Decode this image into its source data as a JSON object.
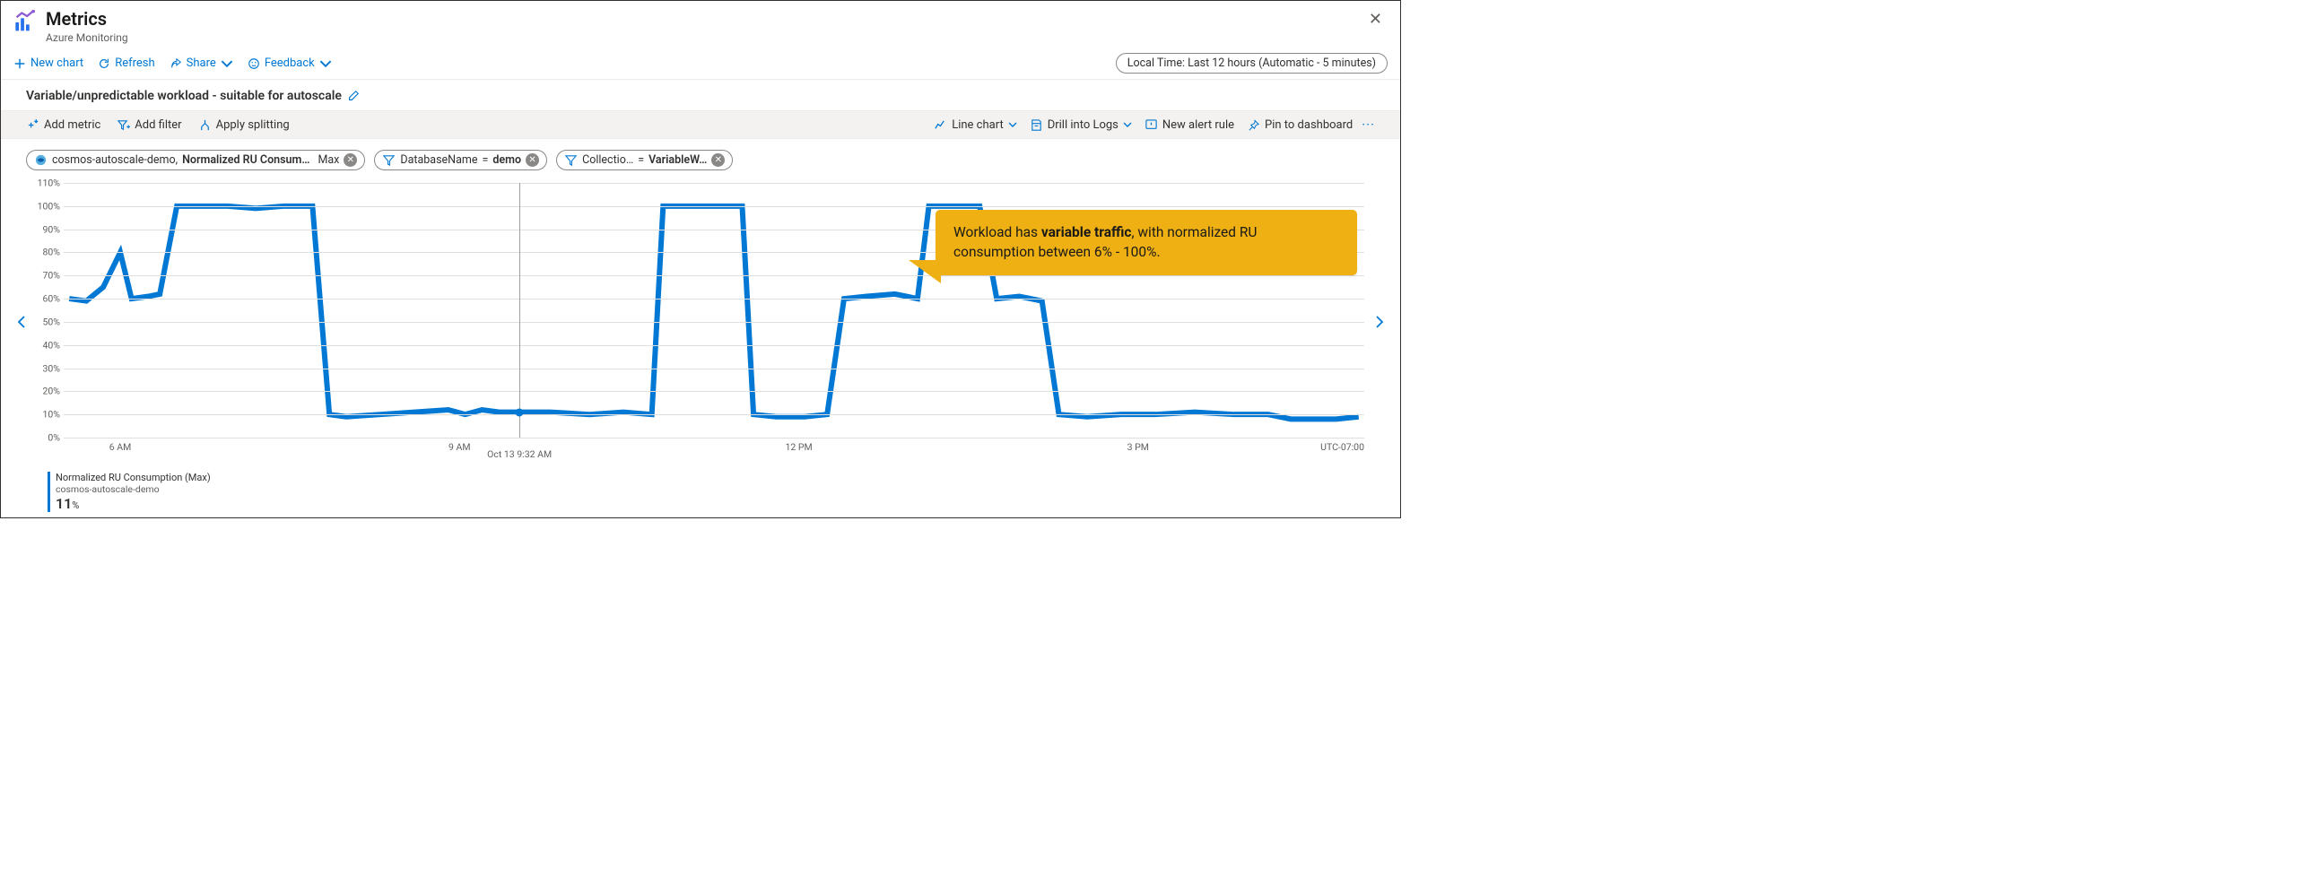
{
  "header": {
    "title": "Metrics",
    "subtitle": "Azure Monitoring"
  },
  "toolbar": {
    "new_chart": "New chart",
    "refresh": "Refresh",
    "share": "Share",
    "feedback": "Feedback",
    "time_range": "Local Time: Last 12 hours (Automatic - 5 minutes)"
  },
  "chart_title": "Variable/unpredictable workload - suitable for autoscale",
  "chart_toolbar": {
    "add_metric": "Add metric",
    "add_filter": "Add filter",
    "apply_splitting": "Apply splitting",
    "line_chart": "Line chart",
    "drill_logs": "Drill into Logs",
    "new_alert": "New alert rule",
    "pin": "Pin to dashboard"
  },
  "pills": {
    "metric_scope": "cosmos-autoscale-demo,",
    "metric_name": "Normalized RU Consum…",
    "metric_agg": "Max",
    "f1_key": "DatabaseName",
    "f1_op": "=",
    "f1_val": "demo",
    "f2_key": "Collectio…",
    "f2_op": "=",
    "f2_val": "VariableW…"
  },
  "axis": {
    "x_ticks": [
      "6 AM",
      "9 AM",
      "12 PM",
      "3 PM"
    ],
    "tz": "UTC-07:00",
    "cursor_label": "Oct 13 9:32 AM"
  },
  "legend": {
    "line1": "Normalized RU Consumption (Max)",
    "line2": "cosmos-autoscale-demo",
    "value": "11",
    "unit": "%"
  },
  "callout": {
    "t1": "Workload has ",
    "t2": "variable traffic",
    "t3": ", with normalized RU consumption between 6% - 100%."
  },
  "chart_data": {
    "type": "line",
    "title": "Normalized RU Consumption (Max)",
    "xlabel": "",
    "ylabel": "",
    "ylim": [
      0,
      110
    ],
    "y_ticks": [
      0,
      10,
      20,
      30,
      40,
      50,
      60,
      70,
      80,
      90,
      100,
      110
    ],
    "x_axis_hours": {
      "start": 5.5,
      "end": 17.0
    },
    "cursor_x_hour": 9.53,
    "cursor_y_value": 11,
    "series": [
      {
        "name": "Normalized RU Consumption (Max)",
        "color": "#0078d4",
        "points": [
          [
            5.55,
            60
          ],
          [
            5.7,
            59
          ],
          [
            5.85,
            65
          ],
          [
            6.0,
            80
          ],
          [
            6.1,
            60
          ],
          [
            6.25,
            61
          ],
          [
            6.35,
            62
          ],
          [
            6.5,
            100
          ],
          [
            6.7,
            100
          ],
          [
            6.95,
            100
          ],
          [
            7.2,
            99
          ],
          [
            7.45,
            100
          ],
          [
            7.7,
            100
          ],
          [
            7.85,
            10
          ],
          [
            8.0,
            9
          ],
          [
            8.3,
            10
          ],
          [
            8.6,
            11
          ],
          [
            8.9,
            12
          ],
          [
            9.05,
            10
          ],
          [
            9.2,
            12
          ],
          [
            9.35,
            11
          ],
          [
            9.53,
            11
          ],
          [
            9.8,
            11
          ],
          [
            10.15,
            10
          ],
          [
            10.45,
            11
          ],
          [
            10.7,
            10
          ],
          [
            10.8,
            100
          ],
          [
            11.0,
            100
          ],
          [
            11.25,
            100
          ],
          [
            11.5,
            100
          ],
          [
            11.6,
            10
          ],
          [
            11.8,
            9
          ],
          [
            12.05,
            9
          ],
          [
            12.25,
            10
          ],
          [
            12.4,
            60
          ],
          [
            12.6,
            61
          ],
          [
            12.85,
            62
          ],
          [
            13.05,
            60
          ],
          [
            13.15,
            100
          ],
          [
            13.35,
            100
          ],
          [
            13.6,
            100
          ],
          [
            13.75,
            60
          ],
          [
            13.95,
            61
          ],
          [
            14.15,
            59
          ],
          [
            14.3,
            10
          ],
          [
            14.55,
            9
          ],
          [
            14.85,
            10
          ],
          [
            15.15,
            10
          ],
          [
            15.5,
            11
          ],
          [
            15.85,
            10
          ],
          [
            16.15,
            10
          ],
          [
            16.35,
            8
          ],
          [
            16.55,
            8
          ],
          [
            16.75,
            8
          ],
          [
            16.95,
            9
          ]
        ]
      }
    ]
  }
}
